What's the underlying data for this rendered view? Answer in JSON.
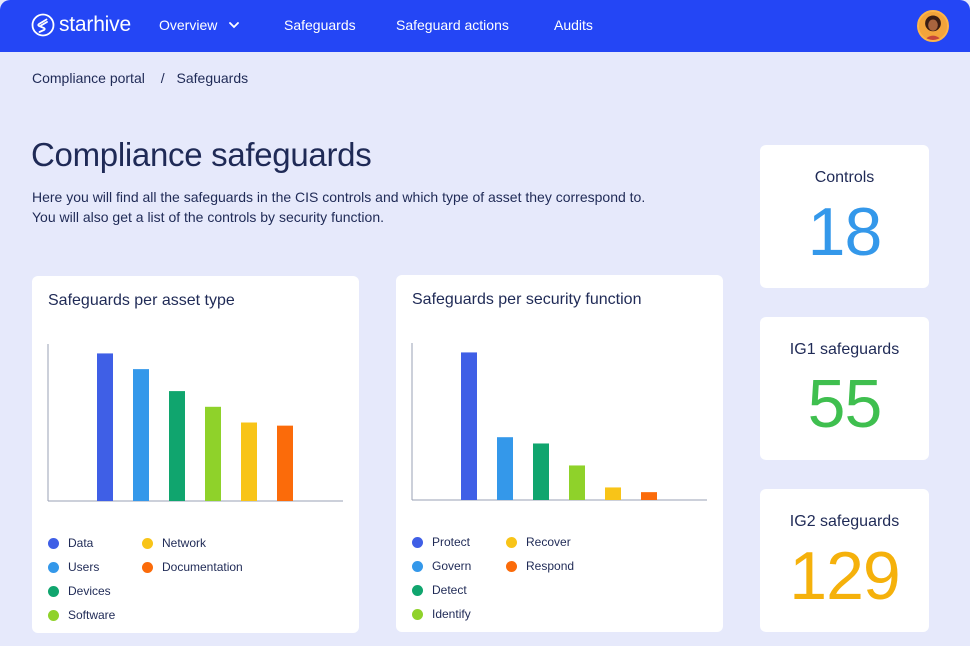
{
  "app": {
    "name": "starhive",
    "nav": [
      {
        "label": "Overview",
        "has_dropdown": true
      },
      {
        "label": "Safeguards"
      },
      {
        "label": "Safeguard actions"
      },
      {
        "label": "Audits"
      }
    ]
  },
  "breadcrumb": [
    "Compliance portal",
    "Safeguards"
  ],
  "breadcrumb_separator": "/",
  "page": {
    "title": "Compliance safeguards",
    "description_lines": [
      "Here you will find all the safeguards in the CIS controls and which type of asset they correspond to.",
      "You will also get a list of the controls by security function."
    ]
  },
  "stats": [
    {
      "label": "Controls",
      "value": "18",
      "color": "#3498ea"
    },
    {
      "label": "IG1 safeguards",
      "value": "55",
      "color": "#3fbf4f"
    },
    {
      "label": "IG2 safeguards",
      "value": "129",
      "color": "#f5b10b"
    }
  ],
  "chart_data": [
    {
      "type": "bar",
      "title": "Safeguards per asset type",
      "categories": [
        "Data",
        "Users",
        "Devices",
        "Software",
        "Network",
        "Documentation"
      ],
      "values": [
        47,
        42,
        35,
        30,
        25,
        24
      ],
      "colors": [
        "#3f5fe6",
        "#3498ea",
        "#10a56e",
        "#8fd22a",
        "#f8c418",
        "#fb6b0a"
      ],
      "ylim": [
        0,
        50
      ],
      "grid": false,
      "legend": "bottom"
    },
    {
      "type": "bar",
      "title": "Safeguards per security function",
      "categories": [
        "Protect",
        "Govern",
        "Detect",
        "Identify",
        "Recover",
        "Respond"
      ],
      "values": [
        47,
        20,
        18,
        11,
        4,
        2.5
      ],
      "colors": [
        "#3f5fe6",
        "#3498ea",
        "#10a56e",
        "#8fd22a",
        "#f8c418",
        "#fb6b0a"
      ],
      "ylim": [
        0,
        50
      ],
      "grid": false,
      "legend": "bottom"
    }
  ]
}
